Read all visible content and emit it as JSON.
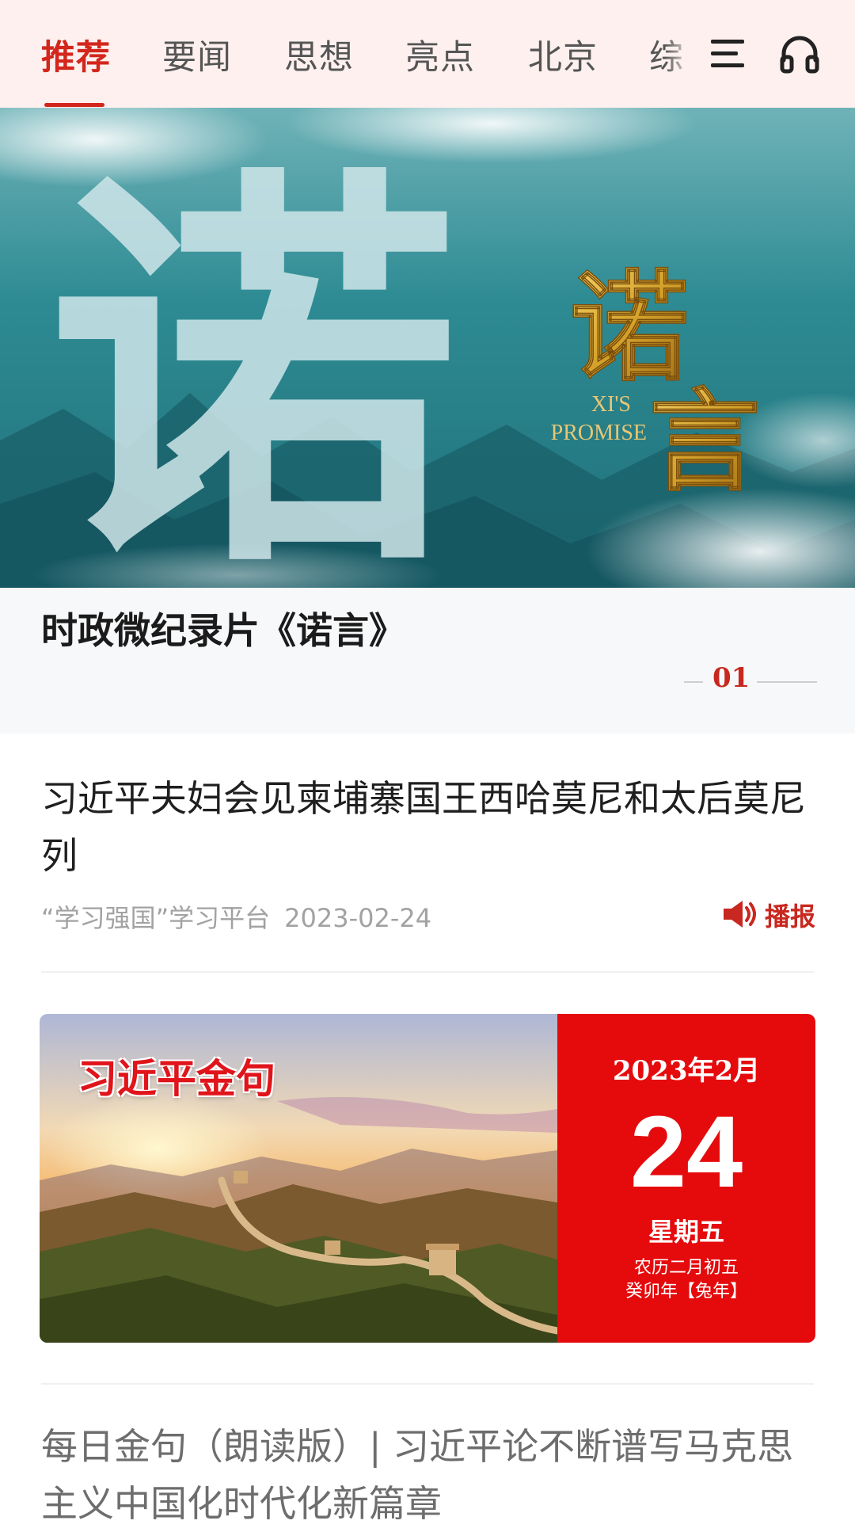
{
  "tabs": [
    {
      "label": "推荐",
      "active": true
    },
    {
      "label": "要闻",
      "active": false
    },
    {
      "label": "思想",
      "active": false
    },
    {
      "label": "亮点",
      "active": false
    },
    {
      "label": "北京",
      "active": false
    },
    {
      "label": "综",
      "active": false
    }
  ],
  "toolbar": {
    "menu_icon": "menu-icon",
    "audio_icon": "headphones-icon"
  },
  "hero": {
    "calligraphy_big": "诺",
    "calligraphy_gold": "诺言",
    "subtitle_line1": "XI'S",
    "subtitle_line2": "PROMISE",
    "title": "时政微纪录片《诺言》",
    "page": "01"
  },
  "articles": [
    {
      "title": "习近平夫妇会见柬埔寨国王西哈莫尼和太后莫尼列",
      "source": "“学习强国”学习平台",
      "date": "2023-02-24",
      "play_label": "播报"
    },
    {
      "title": "每日金句（朗读版）| 习近平论不断谱写马克思主义中国化时代化新篇章"
    }
  ],
  "quote_card": {
    "heading": "习近平金句",
    "year_month": "2023年2月",
    "day": "24",
    "weekday": "星期五",
    "lunar_line1": "农历二月初五",
    "lunar_line2": "癸卯年【兔年】"
  },
  "colors": {
    "accent": "#d3261c",
    "panel_red": "#e50b0d",
    "gold": "#d4a12a"
  }
}
